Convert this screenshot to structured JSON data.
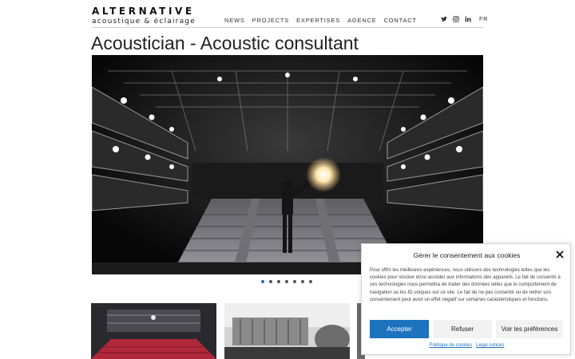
{
  "header": {
    "logo_top": "ALTERNATIVE",
    "logo_bottom": "acoustique & éclairage",
    "nav": [
      "NEWS",
      "PROJECTS",
      "EXPERTISES",
      "AGENCE",
      "CONTACT"
    ],
    "social_icons": [
      "twitter-icon",
      "instagram-icon",
      "linkedin-icon"
    ],
    "lang": "FR"
  },
  "page": {
    "title": "Acoustician - Acoustic consultant"
  },
  "slider": {
    "dot_count": 7,
    "active_index": 0,
    "accent_color": "#1e73be"
  },
  "cookie": {
    "title": "Gérer le consentement aux cookies",
    "body": "Pour offrir les meilleures expériences, nous utilisons des technologies telles que les cookies pour stocker et/ou accéder aux informations des appareils. Le fait de consentir à ces technologies nous permettra de traiter des données telles que le comportement de navigation ou les ID uniques sur ce site. Le fait de ne pas consentir ou de retirer son consentement peut avoir un effet négatif sur certaines caractéristiques et fonctions.",
    "accept": "Accepter",
    "refuse": "Refuser",
    "preferences": "Voir les préférences",
    "links": [
      "Politique de cookies",
      "Legal notices"
    ]
  }
}
